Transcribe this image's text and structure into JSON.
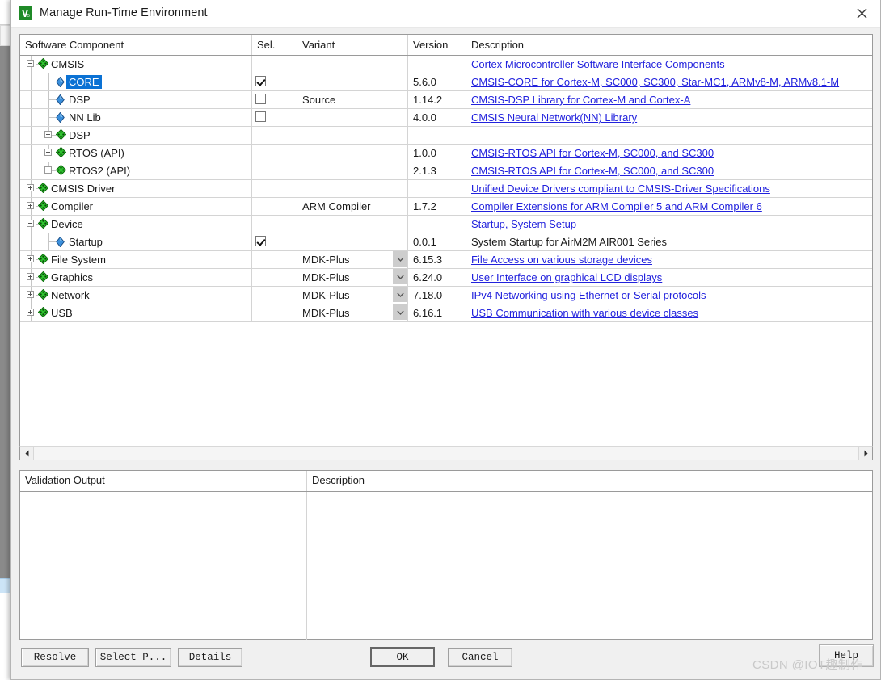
{
  "window": {
    "title": "Manage Run-Time Environment",
    "app_icon": "keil-uvision-icon",
    "close_icon": "close-icon"
  },
  "component_table": {
    "columns": [
      "Software Component",
      "Sel.",
      "Variant",
      "Version",
      "Description"
    ],
    "rows": [
      {
        "label": "CMSIS",
        "depth": 0,
        "icon": "bundle-icon",
        "toggle": "minus",
        "sel_green": true,
        "checkbox": null,
        "variant": "",
        "version": "",
        "description": "Cortex Microcontroller Software Interface Components",
        "desc_link": true,
        "selected": false,
        "dropdown": false
      },
      {
        "label": "CORE",
        "depth": 1,
        "icon": "leaf-icon",
        "toggle": null,
        "sel_green": true,
        "checkbox": "checked",
        "variant": "",
        "version": "5.6.0",
        "description": "CMSIS-CORE for Cortex-M, SC000, SC300, Star-MC1, ARMv8-M, ARMv8.1-M",
        "desc_link": true,
        "selected": true,
        "dropdown": false
      },
      {
        "label": "DSP",
        "depth": 1,
        "icon": "leaf-icon",
        "toggle": null,
        "sel_green": false,
        "checkbox": "unchecked",
        "variant": "Source",
        "version": "1.14.2",
        "description": "CMSIS-DSP Library for Cortex-M and Cortex-A",
        "desc_link": true,
        "selected": false,
        "dropdown": false
      },
      {
        "label": "NN Lib",
        "depth": 1,
        "icon": "leaf-icon",
        "toggle": null,
        "sel_green": false,
        "checkbox": "unchecked",
        "variant": "",
        "version": "4.0.0",
        "description": "CMSIS Neural Network(NN) Library",
        "desc_link": true,
        "selected": false,
        "dropdown": false
      },
      {
        "label": "DSP",
        "depth": 1,
        "icon": "bundle-icon",
        "toggle": "plus",
        "sel_green": false,
        "checkbox": null,
        "variant": "",
        "version": "",
        "description": "",
        "desc_link": false,
        "selected": false,
        "dropdown": false
      },
      {
        "label": "RTOS (API)",
        "depth": 1,
        "icon": "bundle-icon",
        "toggle": "plus",
        "sel_green": false,
        "checkbox": null,
        "variant": "",
        "version": "1.0.0",
        "description": "CMSIS-RTOS API for Cortex-M, SC000, and SC300",
        "desc_link": true,
        "selected": false,
        "dropdown": false
      },
      {
        "label": "RTOS2 (API)",
        "depth": 1,
        "icon": "bundle-icon",
        "toggle": "plus",
        "sel_green": false,
        "checkbox": null,
        "variant": "",
        "version": "2.1.3",
        "description": "CMSIS-RTOS API for Cortex-M, SC000, and SC300",
        "desc_link": true,
        "selected": false,
        "dropdown": false
      },
      {
        "label": "CMSIS Driver",
        "depth": 0,
        "icon": "bundle-icon",
        "toggle": "plus",
        "sel_green": false,
        "checkbox": null,
        "variant": "",
        "version": "",
        "description": "Unified Device Drivers compliant to CMSIS-Driver Specifications",
        "desc_link": true,
        "selected": false,
        "dropdown": false
      },
      {
        "label": "Compiler",
        "depth": 0,
        "icon": "bundle-icon",
        "toggle": "plus",
        "sel_green": false,
        "checkbox": null,
        "variant": "ARM Compiler",
        "version": "1.7.2",
        "description": "Compiler Extensions for ARM Compiler 5 and ARM Compiler 6",
        "desc_link": true,
        "selected": false,
        "dropdown": false
      },
      {
        "label": "Device",
        "depth": 0,
        "icon": "bundle-icon",
        "toggle": "minus",
        "sel_green": true,
        "checkbox": null,
        "variant": "",
        "version": "",
        "description": "Startup, System Setup",
        "desc_link": true,
        "selected": false,
        "dropdown": false
      },
      {
        "label": "Startup",
        "depth": 1,
        "icon": "leaf-icon",
        "toggle": null,
        "sel_green": true,
        "checkbox": "checked",
        "variant": "",
        "version": "0.0.1",
        "description": "System Startup for AirM2M AIR001 Series",
        "desc_link": false,
        "selected": false,
        "dropdown": false
      },
      {
        "label": "File System",
        "depth": 0,
        "icon": "bundle-icon",
        "toggle": "plus",
        "sel_green": false,
        "checkbox": null,
        "variant": "MDK-Plus",
        "version": "6.15.3",
        "description": "File Access on various storage devices",
        "desc_link": true,
        "selected": false,
        "dropdown": true
      },
      {
        "label": "Graphics",
        "depth": 0,
        "icon": "bundle-icon",
        "toggle": "plus",
        "sel_green": false,
        "checkbox": null,
        "variant": "MDK-Plus",
        "version": "6.24.0",
        "description": "User Interface on graphical LCD displays",
        "desc_link": true,
        "selected": false,
        "dropdown": true
      },
      {
        "label": "Network",
        "depth": 0,
        "icon": "bundle-icon",
        "toggle": "plus",
        "sel_green": false,
        "checkbox": null,
        "variant": "MDK-Plus",
        "version": "7.18.0",
        "description": "IPv4 Networking using Ethernet or Serial protocols",
        "desc_link": true,
        "selected": false,
        "dropdown": true
      },
      {
        "label": "USB",
        "depth": 0,
        "icon": "bundle-icon",
        "toggle": "plus",
        "sel_green": false,
        "checkbox": null,
        "variant": "MDK-Plus",
        "version": "6.16.1",
        "description": "USB Communication with various device classes",
        "desc_link": true,
        "selected": false,
        "dropdown": true
      }
    ]
  },
  "scrollbar": {
    "left_arrow_icon": "chevron-left-icon",
    "right_arrow_icon": "chevron-right-icon"
  },
  "validation": {
    "col_output": "Validation Output",
    "col_description": "Description",
    "rows": []
  },
  "footer": {
    "resolve": "Resolve",
    "select_packs": "Select P...",
    "details": "Details",
    "ok": "OK",
    "cancel": "Cancel",
    "help": "Help"
  },
  "watermark": "CSDN @IOT趣制作",
  "colors": {
    "selection_blue": "#0b72d4",
    "green_cell": "#b6f0b6",
    "link_blue": "#2222dd",
    "dialog_bg": "#f0f0f0"
  }
}
